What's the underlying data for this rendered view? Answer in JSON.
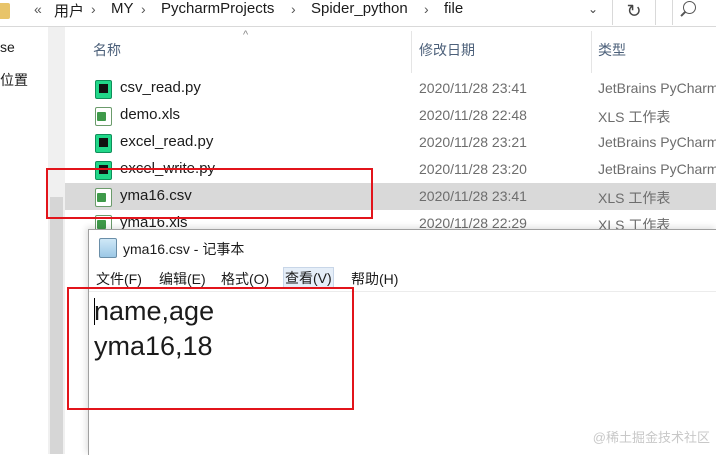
{
  "explorer": {
    "breadcrumb": {
      "overflow": "«",
      "items": [
        "用户",
        "MY",
        "PycharmProjects",
        "Spider_python",
        "file"
      ],
      "separator": "›"
    },
    "dropdown_icon": "chevron-down-icon",
    "refresh_icon": "refresh-icon",
    "refresh_glyph": "↻",
    "search_icon": "search-icon",
    "nav_items": [
      "se",
      "位置"
    ],
    "columns": {
      "name": "名称",
      "modified": "修改日期",
      "type": "类型"
    },
    "sort_glyph": "^",
    "files": [
      {
        "name": "csv_read.py",
        "date": "2020/11/28 23:41",
        "type": "JetBrains PyCharm",
        "icon": "pycharm-file-icon",
        "selected": false
      },
      {
        "name": "demo.xls",
        "date": "2020/11/28 22:48",
        "type": "XLS 工作表",
        "icon": "spreadsheet-file-icon",
        "selected": false
      },
      {
        "name": "excel_read.py",
        "date": "2020/11/28 23:21",
        "type": "JetBrains PyCharm",
        "icon": "pycharm-file-icon",
        "selected": false
      },
      {
        "name": "excel_write.py",
        "date": "2020/11/28 23:20",
        "type": "JetBrains PyCharm",
        "icon": "pycharm-file-icon",
        "selected": false
      },
      {
        "name": "yma16.csv",
        "date": "2020/11/28 23:41",
        "type": "XLS 工作表",
        "icon": "spreadsheet-file-icon",
        "selected": true
      },
      {
        "name": "yma16.xls",
        "date": "2020/11/28 22:29",
        "type": "XLS 工作表",
        "icon": "spreadsheet-file-icon",
        "selected": false
      }
    ]
  },
  "notepad": {
    "title": "yma16.csv - 记事本",
    "icon": "notepad-icon",
    "menu": [
      "文件(F)",
      "编辑(E)",
      "格式(O)",
      "查看(V)",
      "帮助(H)"
    ],
    "active_menu": "查看(V)",
    "content_lines": [
      "name,age",
      "yma16,18"
    ]
  },
  "watermark": "@稀土掘金技术社区",
  "colors": {
    "highlight_red": "#e2141b",
    "selected_row": "#d9d9d9",
    "header_text": "#4c607a",
    "meta_text": "#6d6d6d"
  }
}
